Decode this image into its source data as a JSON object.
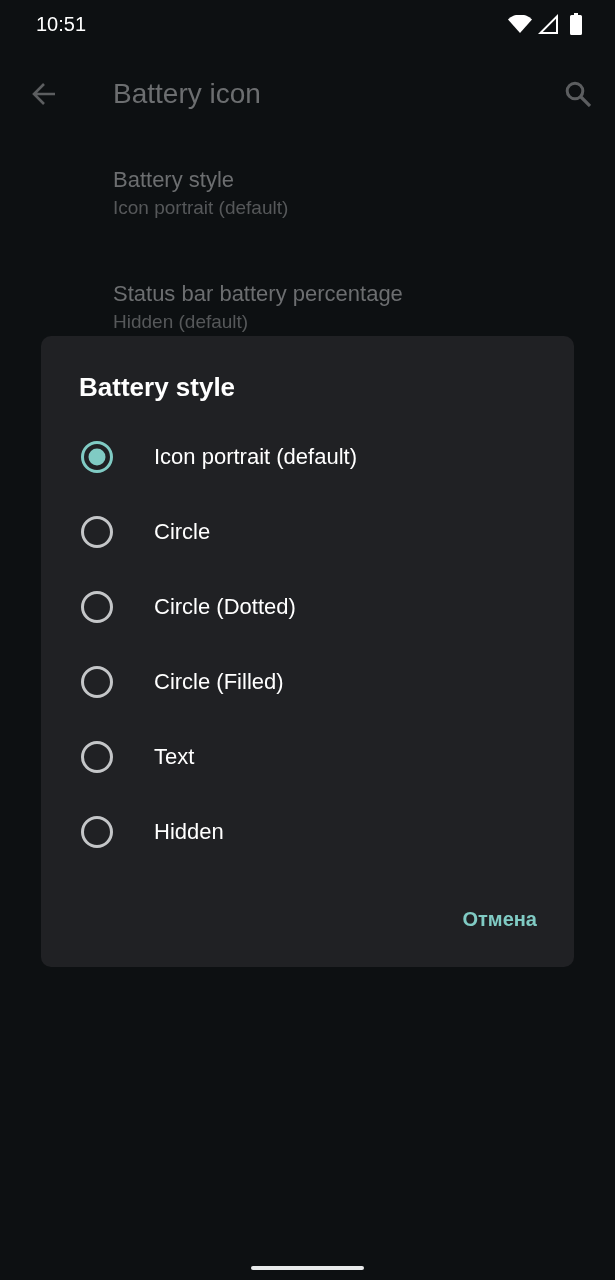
{
  "status_bar": {
    "time": "10:51"
  },
  "app_bar": {
    "title": "Battery icon"
  },
  "settings": [
    {
      "title": "Battery style",
      "summary": "Icon portrait (default)"
    },
    {
      "title": "Status bar battery percentage",
      "summary": "Hidden (default)"
    }
  ],
  "dialog": {
    "title": "Battery style",
    "options": [
      {
        "label": "Icon portrait (default)",
        "selected": true
      },
      {
        "label": "Circle",
        "selected": false
      },
      {
        "label": "Circle (Dotted)",
        "selected": false
      },
      {
        "label": "Circle (Filled)",
        "selected": false
      },
      {
        "label": "Text",
        "selected": false
      },
      {
        "label": "Hidden",
        "selected": false
      }
    ],
    "buttons": [
      "Отмена"
    ]
  }
}
